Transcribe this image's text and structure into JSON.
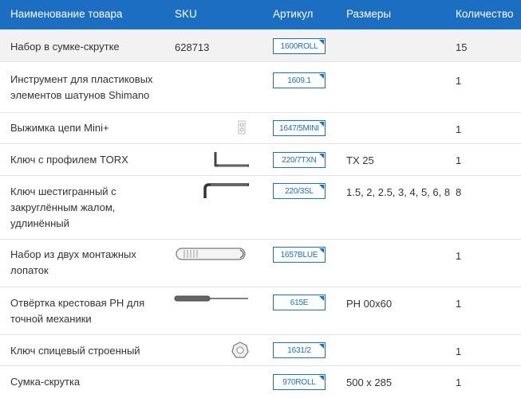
{
  "header": {
    "name": "Наименование товара",
    "sku": "SKU",
    "article": "Артикул",
    "sizes": "Размеры",
    "quantity": "Количество"
  },
  "rows": [
    {
      "name1": "Набор в сумке-скрутке",
      "name2": "",
      "name3": "",
      "sku": "628713",
      "article": "1600ROLL",
      "size": "",
      "qty": "15",
      "image": ""
    },
    {
      "name1": "Инструмент для пластиковых",
      "name2": "элементов шатунов Shimano",
      "name3": "",
      "sku": "",
      "article": "1609.1",
      "size": "",
      "qty": "1",
      "image": ""
    },
    {
      "name1": "Выжимка цепи Mini+",
      "name2": "",
      "name3": "",
      "sku": "",
      "article": "1647/5MINI",
      "size": "",
      "qty": "1",
      "image": "chain-tool"
    },
    {
      "name1": "Ключ с профилем TORX",
      "name2": "",
      "name3": "",
      "sku": "",
      "article": "220/7TXN",
      "size": "TX 25",
      "qty": "1",
      "image": "torx-key"
    },
    {
      "name1": "Ключ шестигранный с",
      "name2": "закруглённым жалом,",
      "name3": "удлинённый",
      "sku": "",
      "article": "220/3SL",
      "size": "1.5, 2, 2.5, 3, 4, 5, 6, 8",
      "qty": "8",
      "image": "hex-key"
    },
    {
      "name1": "Набор из двух монтажных",
      "name2": "лопаток",
      "name3": "",
      "sku": "",
      "article": "1657BLUE",
      "size": "",
      "qty": "1",
      "image": "tire-levers"
    },
    {
      "name1": "Отвёртка крестовая PH для",
      "name2": "точной механики",
      "name3": "",
      "sku": "",
      "article": "615E",
      "size": "PH 00x60",
      "qty": "1",
      "image": "screwdriver"
    },
    {
      "name1": "Ключ спицевый строенный",
      "name2": "",
      "name3": "",
      "sku": "",
      "article": "1631/2",
      "size": "",
      "qty": "1",
      "image": "spoke-wrench"
    },
    {
      "name1": "Сумка-скрутка",
      "name2": "",
      "name3": "",
      "sku": "",
      "article": "970ROLL",
      "size": "500 x 285",
      "qty": "1",
      "image": ""
    }
  ]
}
